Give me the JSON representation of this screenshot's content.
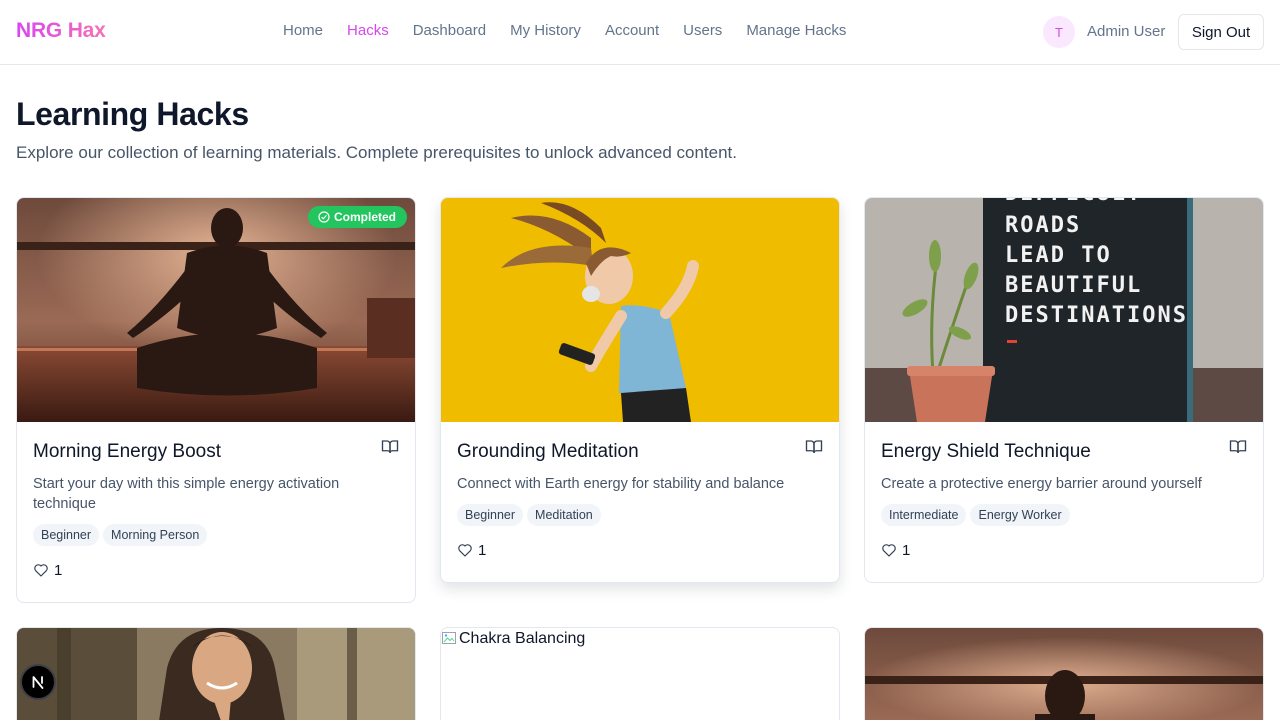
{
  "brand": "NRG Hax",
  "nav": [
    {
      "label": "Home",
      "active": false
    },
    {
      "label": "Hacks",
      "active": true
    },
    {
      "label": "Dashboard",
      "active": false
    },
    {
      "label": "My History",
      "active": false
    },
    {
      "label": "Account",
      "active": false
    },
    {
      "label": "Users",
      "active": false
    },
    {
      "label": "Manage Hacks",
      "active": false
    }
  ],
  "user": {
    "initial": "T",
    "name": "Admin User",
    "signout_label": "Sign Out"
  },
  "page": {
    "title": "Learning Hacks",
    "subtitle": "Explore our collection of learning materials. Complete prerequisites to unlock advanced content."
  },
  "cards": [
    {
      "title": "Morning Energy Boost",
      "description": "Start your day with this simple energy activation technique",
      "tags": [
        "Beginner",
        "Morning Person"
      ],
      "likes": "1",
      "badge": "Completed",
      "image": "meditation-silhouette"
    },
    {
      "title": "Grounding Meditation",
      "description": "Connect with Earth energy for stability and balance",
      "tags": [
        "Beginner",
        "Meditation"
      ],
      "likes": "1",
      "image": "woman-headphones-yellow"
    },
    {
      "title": "Energy Shield Technique",
      "description": "Create a protective energy barrier around yourself",
      "tags": [
        "Intermediate",
        "Energy Worker"
      ],
      "likes": "1",
      "image": "letterboard-plant",
      "image_text": [
        "DIFFICULT",
        "ROADS",
        "LEAD TO",
        "BEAUTIFUL",
        "DESTINATIONS"
      ]
    },
    {
      "image": "woman-praying"
    },
    {
      "image_alt": "Chakra Balancing"
    },
    {
      "image": "meditation-silhouette"
    }
  ],
  "colors": {
    "accent": "#d946ef",
    "badge": "#22c55e",
    "muted": "#64748b"
  },
  "icons": {
    "book": "book-open-icon",
    "heart": "heart-icon",
    "check": "check-circle-icon",
    "next": "nextjs-logo-icon"
  }
}
